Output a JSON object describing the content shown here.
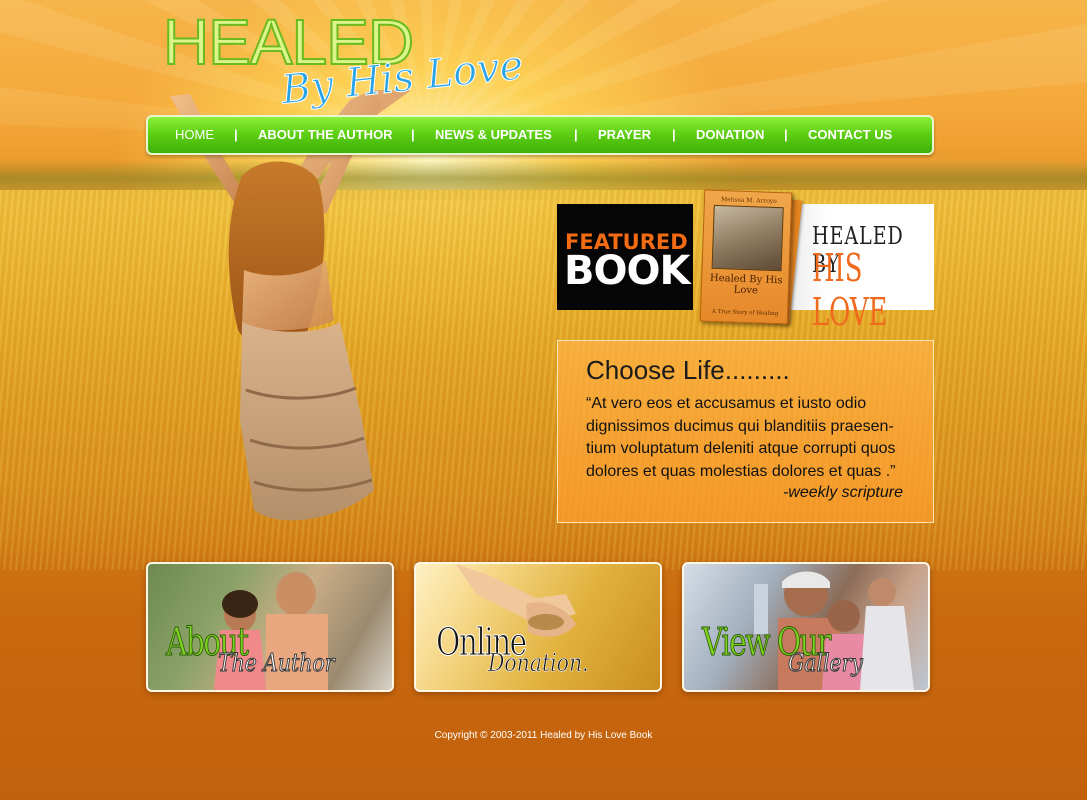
{
  "logo": {
    "main": "HEALED",
    "sub": "By His Love"
  },
  "nav": {
    "items": [
      {
        "label": "HOME"
      },
      {
        "label": "ABOUT THE AUTHOR"
      },
      {
        "label": "NEWS & UPDATES"
      },
      {
        "label": "PRAYER"
      },
      {
        "label": "DONATION"
      },
      {
        "label": "CONTACT US"
      }
    ],
    "separator": "|"
  },
  "featured": {
    "label_top": "FEATURED",
    "label_bottom": "BOOK",
    "title_line1": "HEALED BY",
    "title_line2": "HIS LOVE",
    "book_cover": {
      "author": "Melissa M. Arroyo",
      "title": "Healed By His Love",
      "tagline": "A True Story of Healing"
    }
  },
  "scripture": {
    "heading": "Choose Life.........",
    "quote": "“At vero eos et accusamus et iusto odio dignissimos ducimus qui blanditiis praesen-tium voluptatum deleniti atque corrupti quos dolores et quas molestias dolores et quas .”",
    "attribution": "-weekly scripture"
  },
  "cards": [
    {
      "big": "About",
      "small": "The Author"
    },
    {
      "big": "Online",
      "small": "Donation."
    },
    {
      "big": "View Our",
      "small": "Gallery"
    }
  ],
  "footer": {
    "copyright": "Copyright © 2003-2011 Healed by His Love Book"
  },
  "colors": {
    "nav_green": "#5fd014",
    "logo_blue": "#27a3e6",
    "logo_green": "#6cbb1e",
    "accent_orange": "#f06a1e"
  }
}
